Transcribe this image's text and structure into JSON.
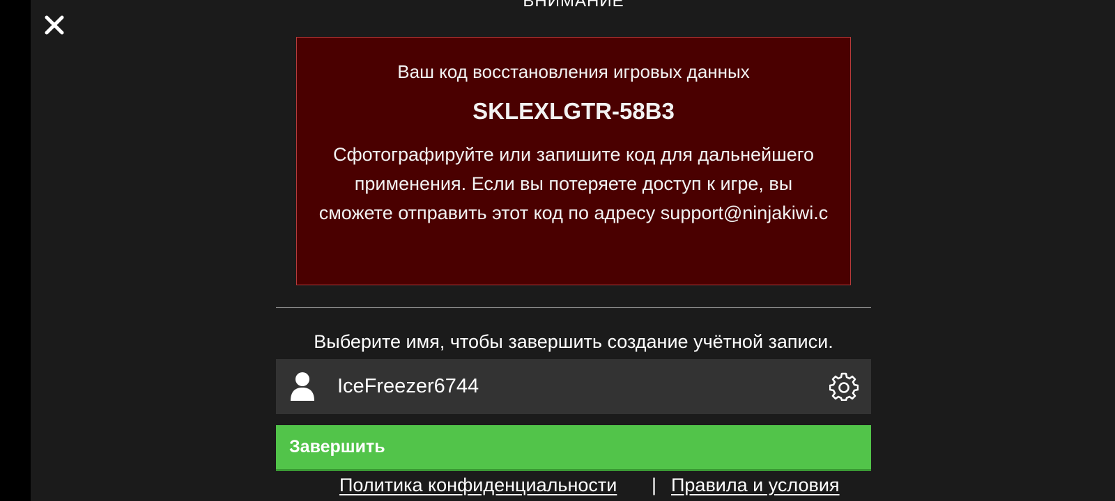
{
  "header": {
    "title": "ВНИМАНИЕ"
  },
  "warning": {
    "heading": "Ваш код восстановления игровых данных",
    "code": "SKLEXLGTR-58B3",
    "body": "Сфотографируйте или запишите код для дальнейшего применения. Если вы потеряете доступ к игре, вы сможете отправить этот код по адресу support@ninjakiwi.c"
  },
  "account": {
    "prompt": "Выберите имя, чтобы завершить создание учётной записи.",
    "username": "IceFreezer6744"
  },
  "actions": {
    "finish_label": "Завершить"
  },
  "footer": {
    "privacy_label": "Политика конфиденциальности",
    "separator": "|",
    "terms_label": "Правила и условия"
  },
  "colors": {
    "background": "#1b1b1b",
    "warning_bg": "#4a0000",
    "warning_border": "#b83b3b",
    "field_bg": "#333333",
    "finish_bg": "#52c44a"
  },
  "icons": {
    "close": "close-icon",
    "user": "user-icon",
    "settings": "gear-icon"
  }
}
